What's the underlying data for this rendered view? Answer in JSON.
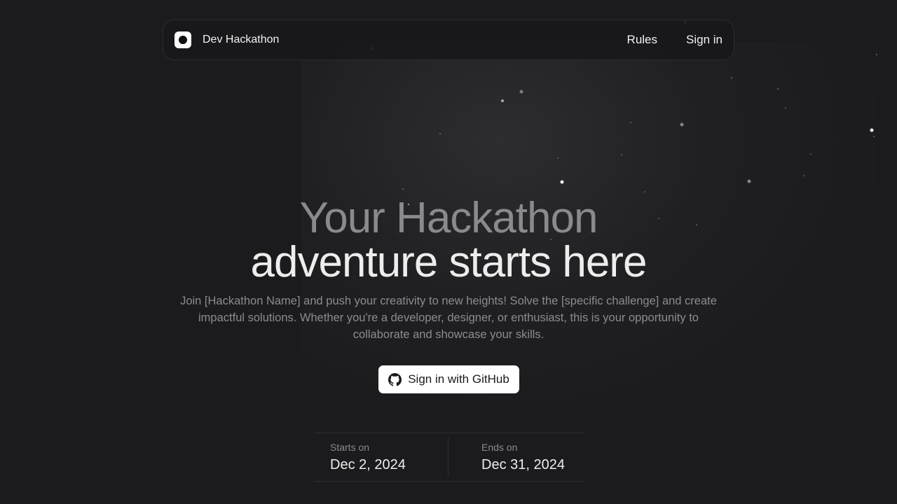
{
  "nav": {
    "brand": "Dev Hackathon",
    "links": [
      "Rules",
      "Sign in"
    ]
  },
  "hero": {
    "title_line1": "Your Hackathon",
    "title_line2": "adventure starts here",
    "description": "Join [Hackathon Name] and push your creativity to new heights! Solve the [specific challenge] and create impactful solutions. Whether you're a developer, designer, or enthusiast, this is your opportunity to collaborate and showcase your skills.",
    "cta_label": "Sign in with GitHub",
    "cta_icon": "github-icon"
  },
  "dates": {
    "start_label": "Starts on",
    "start_value": "Dec 2, 2024",
    "end_label": "Ends on",
    "end_value": "Dec 31, 2024"
  },
  "colors": {
    "background": "#1b1b1d",
    "title_muted": "#8a8a8c",
    "title_bright": "#ededed",
    "button_bg": "#ffffff"
  }
}
